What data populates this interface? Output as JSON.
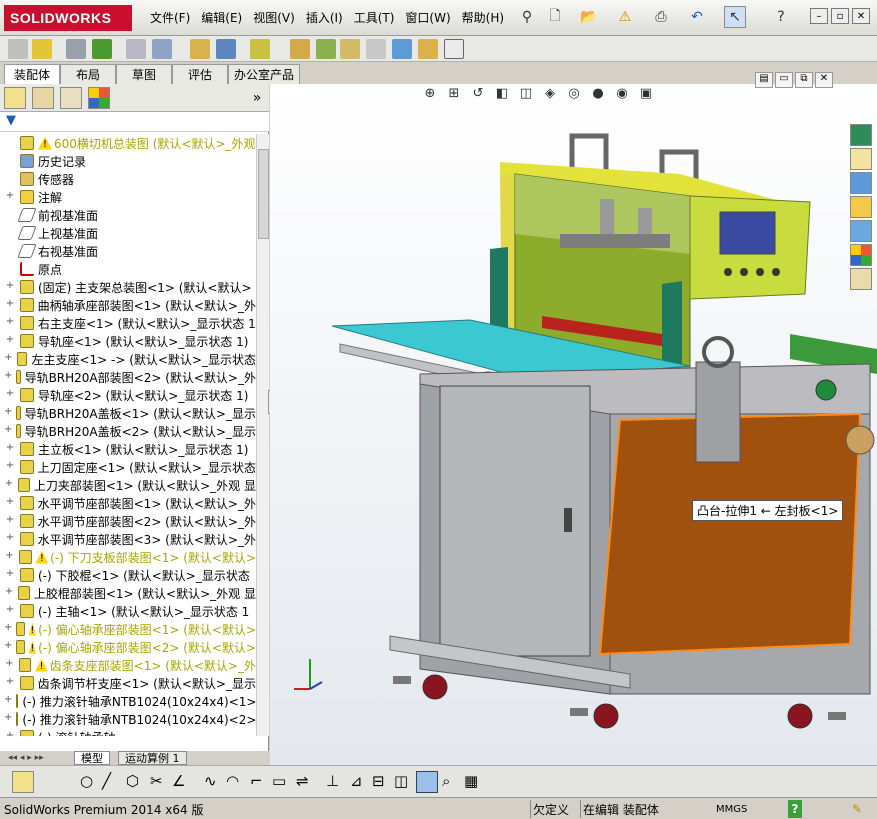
{
  "app": {
    "logo": "SOLIDWORKS"
  },
  "menu": [
    "文件(F)",
    "编辑(E)",
    "视图(V)",
    "插入(I)",
    "工具(T)",
    "窗口(W)",
    "帮助(H)"
  ],
  "tabs": [
    "装配体",
    "布局",
    "草图",
    "评估",
    "办公室产品"
  ],
  "filter_icon": "funnel-icon",
  "tree": [
    {
      "label": "600横切机总装图  (默认<默认>_外观",
      "expand": "",
      "warn": true,
      "yellow": true,
      "icon": "assembly-icon"
    },
    {
      "label": "历史记录",
      "expand": "",
      "warn": false,
      "yellow": false,
      "icon": "history-icon"
    },
    {
      "label": "传感器",
      "expand": "",
      "warn": false,
      "yellow": false,
      "icon": "sensor-icon"
    },
    {
      "label": "注解",
      "expand": "+",
      "warn": false,
      "yellow": false,
      "icon": "annotation-icon"
    },
    {
      "label": "前视基准面",
      "expand": "",
      "warn": false,
      "yellow": false,
      "icon": "plane-icon"
    },
    {
      "label": "上视基准面",
      "expand": "",
      "warn": false,
      "yellow": false,
      "icon": "plane-icon"
    },
    {
      "label": "右视基准面",
      "expand": "",
      "warn": false,
      "yellow": false,
      "icon": "plane-icon"
    },
    {
      "label": "原点",
      "expand": "",
      "warn": false,
      "yellow": false,
      "icon": "origin-icon"
    },
    {
      "label": "(固定) 主支架总装图<1> (默认<默认>",
      "expand": "+",
      "warn": false,
      "yellow": false,
      "icon": "subassembly-icon"
    },
    {
      "label": "曲柄轴承座部装图<1> (默认<默认>_外",
      "expand": "+",
      "warn": false,
      "yellow": false,
      "icon": "subassembly-icon"
    },
    {
      "label": "右主支座<1> (默认<默认>_显示状态 1",
      "expand": "+",
      "warn": false,
      "yellow": false,
      "icon": "part-icon"
    },
    {
      "label": "导轨座<1> (默认<默认>_显示状态 1)",
      "expand": "+",
      "warn": false,
      "yellow": false,
      "icon": "part-icon"
    },
    {
      "label": "左主支座<1> -> (默认<默认>_显示状态",
      "expand": "+",
      "warn": false,
      "yellow": false,
      "icon": "part-icon"
    },
    {
      "label": "导轨BRH20A部装图<2> (默认<默认>_外",
      "expand": "+",
      "warn": false,
      "yellow": false,
      "icon": "subassembly-icon"
    },
    {
      "label": "导轨座<2> (默认<默认>_显示状态 1)",
      "expand": "+",
      "warn": false,
      "yellow": false,
      "icon": "part-icon"
    },
    {
      "label": "导轨BRH20A盖板<1> (默认<默认>_显示",
      "expand": "+",
      "warn": false,
      "yellow": false,
      "icon": "part-icon"
    },
    {
      "label": "导轨BRH20A盖板<2> (默认<默认>_显示",
      "expand": "+",
      "warn": false,
      "yellow": false,
      "icon": "part-icon"
    },
    {
      "label": "主立板<1> (默认<默认>_显示状态 1)",
      "expand": "+",
      "warn": false,
      "yellow": false,
      "icon": "part-icon"
    },
    {
      "label": "上刀固定座<1> (默认<默认>_显示状态",
      "expand": "+",
      "warn": false,
      "yellow": false,
      "icon": "part-icon"
    },
    {
      "label": "上刀夹部装图<1> (默认<默认>_外观 显",
      "expand": "+",
      "warn": false,
      "yellow": false,
      "icon": "subassembly-icon"
    },
    {
      "label": "水平调节座部装图<1> (默认<默认>_外",
      "expand": "+",
      "warn": false,
      "yellow": false,
      "icon": "subassembly-icon"
    },
    {
      "label": "水平调节座部装图<2> (默认<默认>_外",
      "expand": "+",
      "warn": false,
      "yellow": false,
      "icon": "subassembly-icon"
    },
    {
      "label": "水平调节座部装图<3> (默认<默认>_外",
      "expand": "+",
      "warn": false,
      "yellow": false,
      "icon": "subassembly-icon"
    },
    {
      "label": "(-) 下刀支板部装图<1> (默认<默认>",
      "expand": "+",
      "warn": true,
      "yellow": true,
      "icon": "subassembly-icon"
    },
    {
      "label": "(-) 下胶棍<1> (默认<默认>_显示状态",
      "expand": "+",
      "warn": false,
      "yellow": false,
      "icon": "part-icon"
    },
    {
      "label": "上胶棍部装图<1> (默认<默认>_外观 显",
      "expand": "+",
      "warn": false,
      "yellow": false,
      "icon": "subassembly-icon"
    },
    {
      "label": "(-) 主轴<1> (默认<默认>_显示状态 1",
      "expand": "+",
      "warn": false,
      "yellow": false,
      "icon": "part-icon"
    },
    {
      "label": "(-) 偏心轴承座部装图<1> (默认<默认>",
      "expand": "+",
      "warn": true,
      "yellow": true,
      "icon": "subassembly-icon"
    },
    {
      "label": "(-) 偏心轴承座部装图<2> (默认<默认>",
      "expand": "+",
      "warn": true,
      "yellow": true,
      "icon": "subassembly-icon"
    },
    {
      "label": "齿条支座部装图<1> (默认<默认>_外",
      "expand": "+",
      "warn": true,
      "yellow": true,
      "icon": "subassembly-icon"
    },
    {
      "label": "齿条调节杆支座<1> (默认<默认>_显示",
      "expand": "+",
      "warn": false,
      "yellow": false,
      "icon": "part-icon"
    },
    {
      "label": "(-) 推力滚针轴承NTB1024(10x24x4)<1>",
      "expand": "+",
      "warn": false,
      "yellow": false,
      "icon": "part-icon"
    },
    {
      "label": "(-) 推力滚针轴承NTB1024(10x24x4)<2>",
      "expand": "+",
      "warn": false,
      "yellow": false,
      "icon": "part-icon"
    },
    {
      "label": "(-) 滚针轴承轴",
      "expand": "+",
      "warn": false,
      "yellow": false,
      "icon": "part-icon"
    }
  ],
  "bottom_tabs": [
    "模型",
    "运动算例 1"
  ],
  "tooltip": "凸台-拉伸1 ← 左封板<1>",
  "status": {
    "app": "SolidWorks Premium 2014 x64 版",
    "undef": "欠定义",
    "editing": "在编辑 装配体",
    "units": "MMGS",
    "help": "?"
  },
  "colors": {
    "brand": "#c8102e",
    "warn": "#ffd400",
    "tree_yellow": "#a6a600",
    "selected_face": "#a0510e"
  }
}
